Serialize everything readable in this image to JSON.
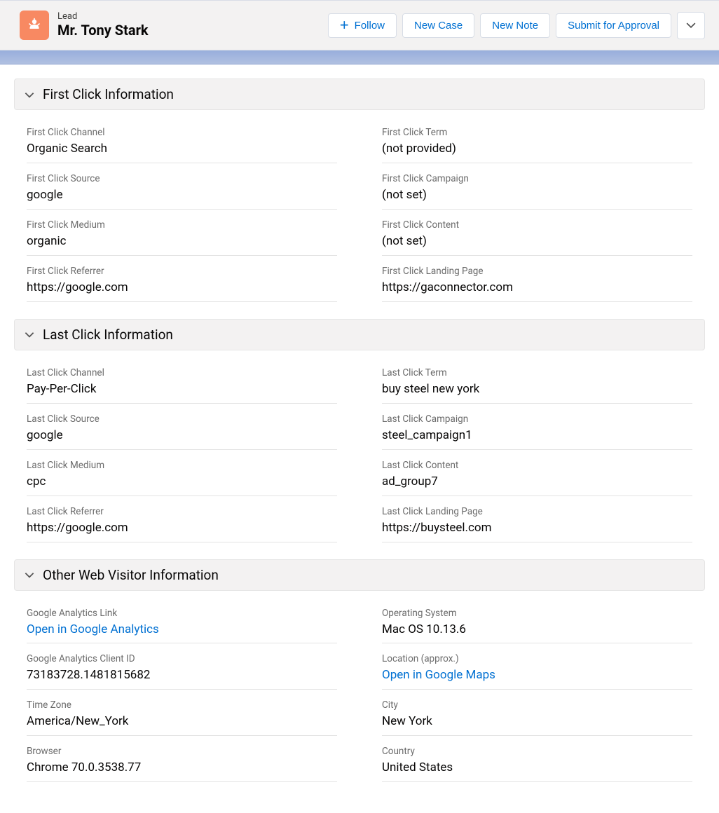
{
  "header": {
    "object_type": "Lead",
    "object_name": "Mr. Tony Stark",
    "actions": {
      "follow": "Follow",
      "new_case": "New Case",
      "new_note": "New Note",
      "submit_approval": "Submit for Approval"
    }
  },
  "sections": {
    "first_click": {
      "title": "First Click Information",
      "fields": {
        "channel_label": "First Click Channel",
        "channel_value": "Organic Search",
        "term_label": "First Click Term",
        "term_value": "(not provided)",
        "source_label": "First Click Source",
        "source_value": "google",
        "campaign_label": "First Click Campaign",
        "campaign_value": "(not set)",
        "medium_label": "First Click Medium",
        "medium_value": "organic",
        "content_label": "First Click Content",
        "content_value": "(not set)",
        "referrer_label": "First Click Referrer",
        "referrer_value": "https://google.com",
        "landing_label": "First Click Landing Page",
        "landing_value": "https://gaconnector.com"
      }
    },
    "last_click": {
      "title": "Last Click Information",
      "fields": {
        "channel_label": "Last Click Channel",
        "channel_value": "Pay-Per-Click",
        "term_label": "Last Click Term",
        "term_value": "buy steel new york",
        "source_label": "Last Click Source",
        "source_value": "google",
        "campaign_label": "Last Click Campaign",
        "campaign_value": "steel_campaign1",
        "medium_label": "Last Click Medium",
        "medium_value": "cpc",
        "content_label": "Last Click Content",
        "content_value": "ad_group7",
        "referrer_label": "Last Click Referrer",
        "referrer_value": "https://google.com",
        "landing_label": "Last Click Landing Page",
        "landing_value": "https://buysteel.com"
      }
    },
    "other": {
      "title": "Other Web Visitor Information",
      "fields": {
        "ga_link_label": "Google Analytics Link",
        "ga_link_value": "Open in Google Analytics",
        "os_label": "Operating System",
        "os_value": "Mac OS 10.13.6",
        "client_id_label": "Google Analytics Client ID",
        "client_id_value": "73183728.1481815682",
        "location_label": "Location (approx.)",
        "location_value": "Open in Google Maps",
        "tz_label": "Time Zone",
        "tz_value": "America/New_York",
        "city_label": "City",
        "city_value": "New York",
        "browser_label": "Browser",
        "browser_value": "Chrome 70.0.3538.77",
        "country_label": "Country",
        "country_value": "United States"
      }
    }
  }
}
